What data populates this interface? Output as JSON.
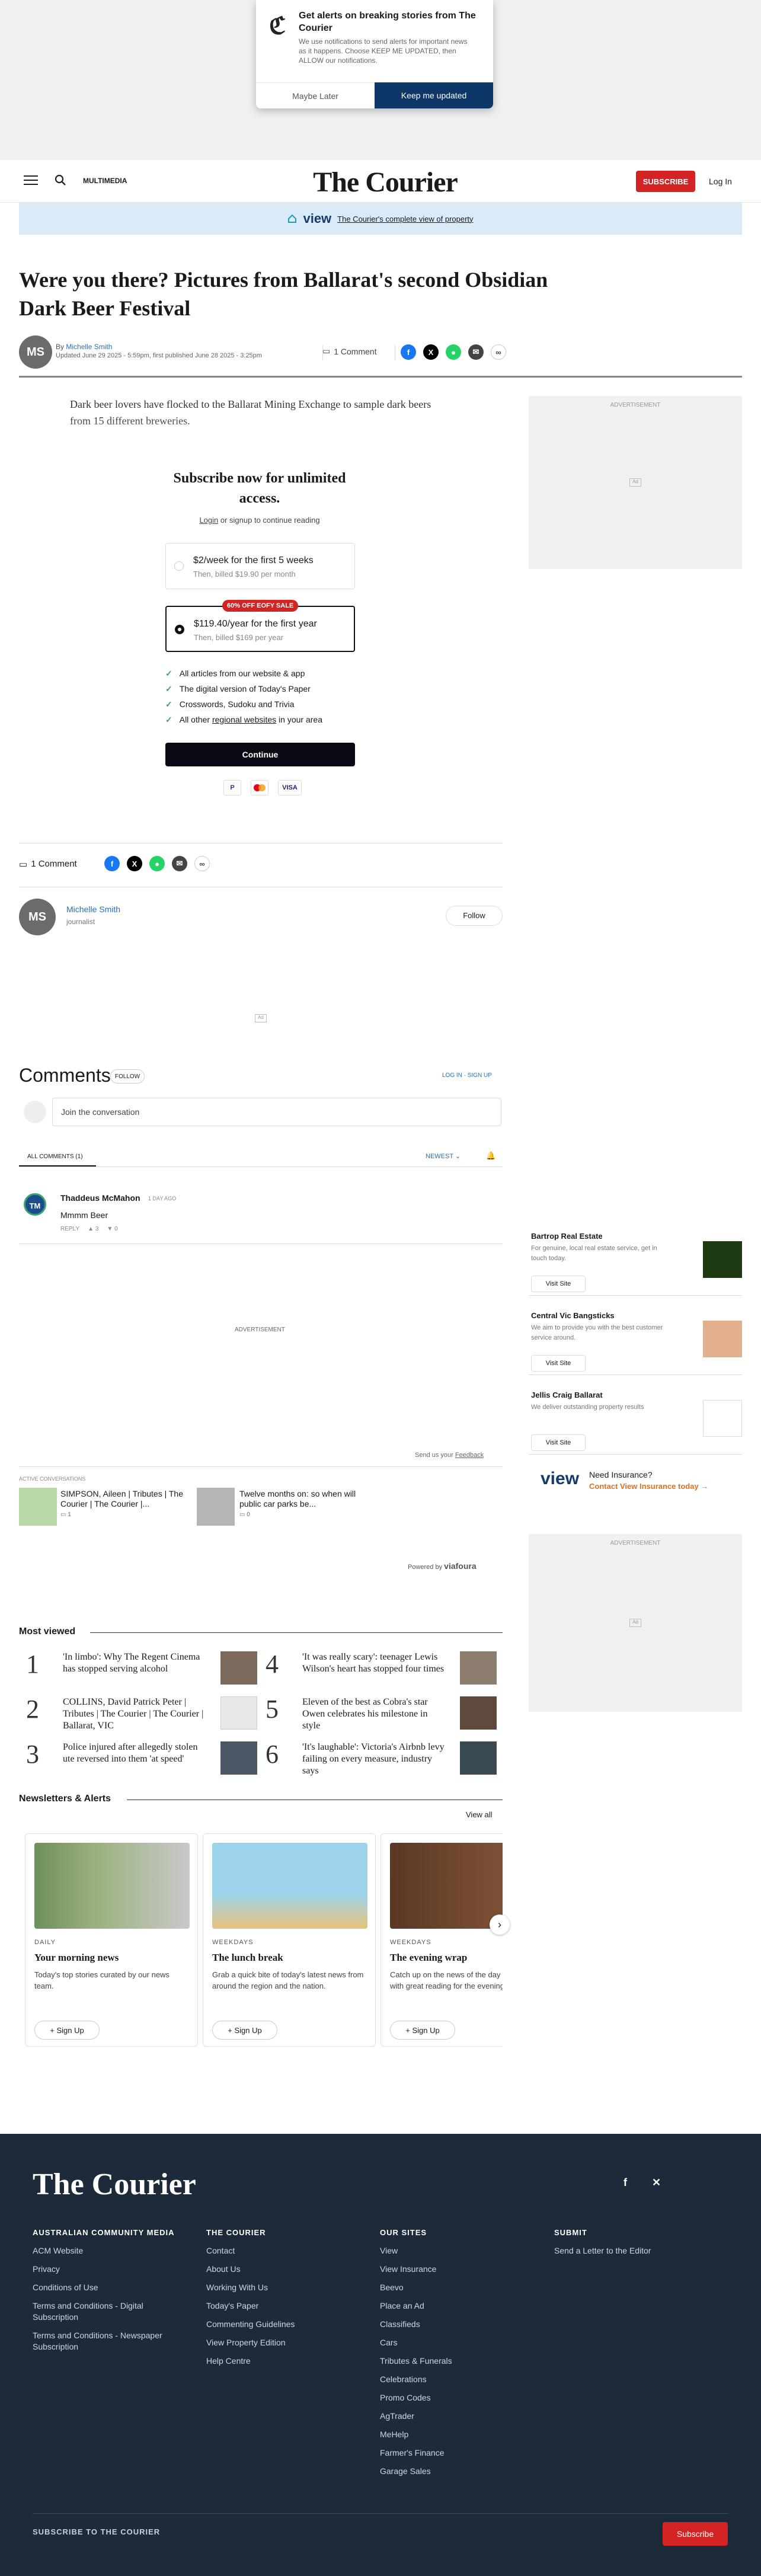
{
  "notification": {
    "title": "Get alerts on breaking stories from The Courier",
    "body": "We use notifications to send alerts for important news as it happens. Choose KEEP ME UPDATED, then ALLOW our notifications.",
    "later": "Maybe Later",
    "keep": "Keep me updated"
  },
  "header": {
    "multimedia": "MULTIMEDIA",
    "brand": "The Courier",
    "subscribe": "SUBSCRIBE",
    "login": "Log In"
  },
  "viewbar": {
    "logo": "view",
    "link": "The Courier's complete view of property"
  },
  "article": {
    "title": "Were you there? Pictures from Ballarat's second Obsidian Dark Beer Festival",
    "author_initials": "MS",
    "by": "By",
    "author": "Michelle Smith",
    "updated": "Updated June 29 2025 - 5:59pm, first published June 28 2025 - 3:25pm",
    "comments": "1 Comment",
    "teaser": "Dark beer lovers have flocked to the Ballarat Mining Exchange to sample dark beers from 15 different breweries."
  },
  "paywall": {
    "heading": "Subscribe now for unlimited access.",
    "login_link": "Login",
    "login_rest": "or signup to continue reading",
    "opt1_price": "$2/week for the first 5 weeks",
    "opt1_then": "Then, billed $19.90 per month",
    "badge": "60% OFF EOFY SALE",
    "opt2_price": "$119.40/year for the first year",
    "opt2_then": "Then, billed $169 per year",
    "features": [
      "All articles from our website & app",
      "The digital version of Today's Paper",
      "Crosswords, Sudoku and Trivia"
    ],
    "feature4_pre": "All other",
    "feature4_link": "regional websites",
    "feature4_post": "in your area",
    "continue": "Continue",
    "pay": [
      "PayPal",
      "Mastercard",
      "VISA"
    ]
  },
  "author_box": {
    "initials": "MS",
    "name": "Michelle Smith",
    "role": "journalist",
    "follow": "Follow"
  },
  "ads": {
    "label": "ADVERTISEMENT",
    "ad": "Ad"
  },
  "comments": {
    "heading": "Comments",
    "follow": "FOLLOW",
    "login": "LOG IN",
    "signup": "SIGN UP",
    "join": "Join the conversation",
    "all": "ALL COMMENTS",
    "count": "1",
    "sort": "NEWEST",
    "comment": {
      "initials": "TM",
      "name": "Thaddeus McMahon",
      "time": "1 DAY AGO",
      "text": "Mmmm Beer",
      "reply": "REPLY",
      "up": "3",
      "down": "0"
    },
    "feedback_pre": "Send us your",
    "feedback_link": "Feedback",
    "active": "ACTIVE CONVERSATIONS",
    "conv": [
      {
        "title": "SIMPSON, Aileen | Tributes | The Courier | The Courier |...",
        "count": "1"
      },
      {
        "title": "Twelve months on: so when will public car parks be...",
        "count": "0"
      }
    ],
    "powered": "Powered by",
    "vendor": "viafoura"
  },
  "sidebar": {
    "ads": [
      {
        "name": "Bartrop Real Estate",
        "text": "For genuine, local real estate service, get in touch today.",
        "visit": "Visit Site"
      },
      {
        "name": "Central Vic Bangsticks",
        "text": "We aim to provide you with the best customer service around.",
        "visit": "Visit Site"
      },
      {
        "name": "Jellis Craig Ballarat",
        "text": "We deliver outstanding property results",
        "visit": "Visit Site"
      }
    ],
    "insurance_q": "Need Insurance?",
    "insurance_link": "Contact View Insurance today →"
  },
  "most_viewed": {
    "heading": "Most viewed",
    "items": [
      {
        "n": "1",
        "t": "'In limbo': Why The Regent Cinema has stopped serving alcohol"
      },
      {
        "n": "2",
        "t": "COLLINS, David Patrick Peter | Tributes | The Courier | The Courier | Ballarat, VIC"
      },
      {
        "n": "3",
        "t": "Police injured after allegedly stolen ute reversed into them 'at speed'"
      },
      {
        "n": "4",
        "t": "'It was really scary': teenager Lewis Wilson's heart has stopped four times"
      },
      {
        "n": "5",
        "t": "Eleven of the best as Cobra's star Owen celebrates his milestone in style"
      },
      {
        "n": "6",
        "t": "'It's laughable': Victoria's Airbnb levy failing on every measure, industry says"
      }
    ]
  },
  "newsletters": {
    "heading": "Newsletters & Alerts",
    "view_all": "View all",
    "cards": [
      {
        "k": "DAILY",
        "title": "Your morning news",
        "text": "Today's top stories curated by our news team.",
        "signup": "Sign Up"
      },
      {
        "k": "WEEKDAYS",
        "title": "The lunch break",
        "text": "Grab a quick bite of today's latest news from around the region and the nation.",
        "signup": "Sign Up"
      },
      {
        "k": "WEEKDAYS",
        "title": "The evening wrap",
        "text": "Catch up on the news of the day and unwind with great reading for the evening.",
        "signup": "Sign Up"
      }
    ]
  },
  "footer": {
    "brand": "The Courier",
    "cols": [
      {
        "h": "AUSTRALIAN COMMUNITY MEDIA",
        "links": [
          "ACM Website",
          "Privacy",
          "Conditions of Use",
          "Terms and Conditions - Digital Subscription",
          "Terms and Conditions - Newspaper Subscription"
        ]
      },
      {
        "h": "THE COURIER",
        "links": [
          "Contact",
          "About Us",
          "Working With Us",
          "Today's Paper",
          "Commenting Guidelines",
          "View Property Edition",
          "Help Centre"
        ]
      },
      {
        "h": "OUR SITES",
        "links": [
          "View",
          "View Insurance",
          "Beevo",
          "Place an Ad",
          "Classifieds",
          "Cars",
          "Tributes & Funerals",
          "Celebrations",
          "Promo Codes",
          "AgTrader",
          "MeHelp",
          "Farmer's Finance",
          "Garage Sales"
        ]
      },
      {
        "h": "SUBMIT",
        "links": [
          "Send a Letter to the Editor"
        ]
      }
    ],
    "subscribe_text": "SUBSCRIBE TO THE COURIER",
    "subscribe_btn": "Subscribe"
  },
  "colors": {
    "brand_red": "#d32323",
    "navy": "#0c3766",
    "footer_bg": "#1d2a3a"
  }
}
